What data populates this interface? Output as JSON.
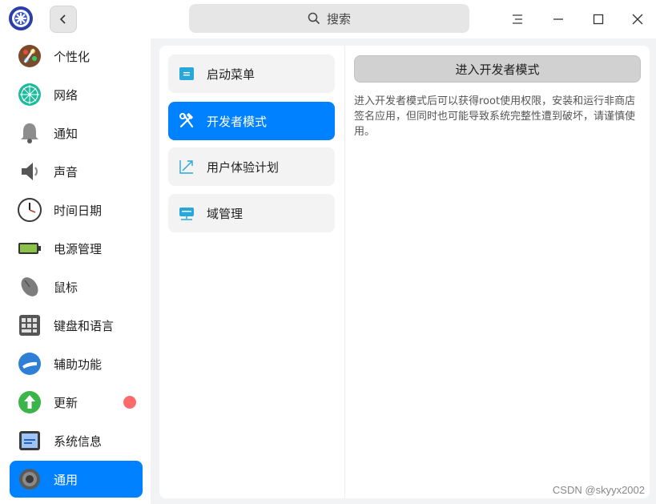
{
  "titlebar": {
    "search_placeholder": "搜索",
    "icons": [
      "app-logo-icon",
      "back-icon",
      "search-icon",
      "menu-icon",
      "minimize-icon",
      "maximize-icon",
      "close-icon"
    ]
  },
  "sidebar": {
    "items": [
      {
        "label": "个性化",
        "icon": "personalization-icon"
      },
      {
        "label": "网络",
        "icon": "network-icon"
      },
      {
        "label": "通知",
        "icon": "bell-icon"
      },
      {
        "label": "声音",
        "icon": "speaker-icon"
      },
      {
        "label": "时间日期",
        "icon": "clock-icon"
      },
      {
        "label": "电源管理",
        "icon": "battery-icon"
      },
      {
        "label": "鼠标",
        "icon": "mouse-icon"
      },
      {
        "label": "键盘和语言",
        "icon": "keyboard-icon"
      },
      {
        "label": "辅助功能",
        "icon": "accessibility-icon"
      },
      {
        "label": "更新",
        "icon": "update-icon",
        "has_badge": true
      },
      {
        "label": "系统信息",
        "icon": "system-info-icon"
      },
      {
        "label": "通用",
        "icon": "general-gear-icon",
        "active": true
      }
    ]
  },
  "middle": {
    "items": [
      {
        "label": "启动菜单",
        "icon": "boot-menu-icon"
      },
      {
        "label": "开发者模式",
        "icon": "developer-tools-icon",
        "active": true
      },
      {
        "label": "用户体验计划",
        "icon": "trend-icon"
      },
      {
        "label": "域管理",
        "icon": "domain-icon"
      }
    ]
  },
  "content": {
    "button_label": "进入开发者模式",
    "description": "进入开发者模式后可以获得root使用权限，安装和运行非商店签名应用，但同时也可能导致系统完整性遭到破坏，请谨慎使用。"
  },
  "watermark": "CSDN @skyyx2002",
  "colors": {
    "accent": "#0081ff",
    "badge": "#ff6b6b",
    "window_bg": "#f2f3f5"
  }
}
